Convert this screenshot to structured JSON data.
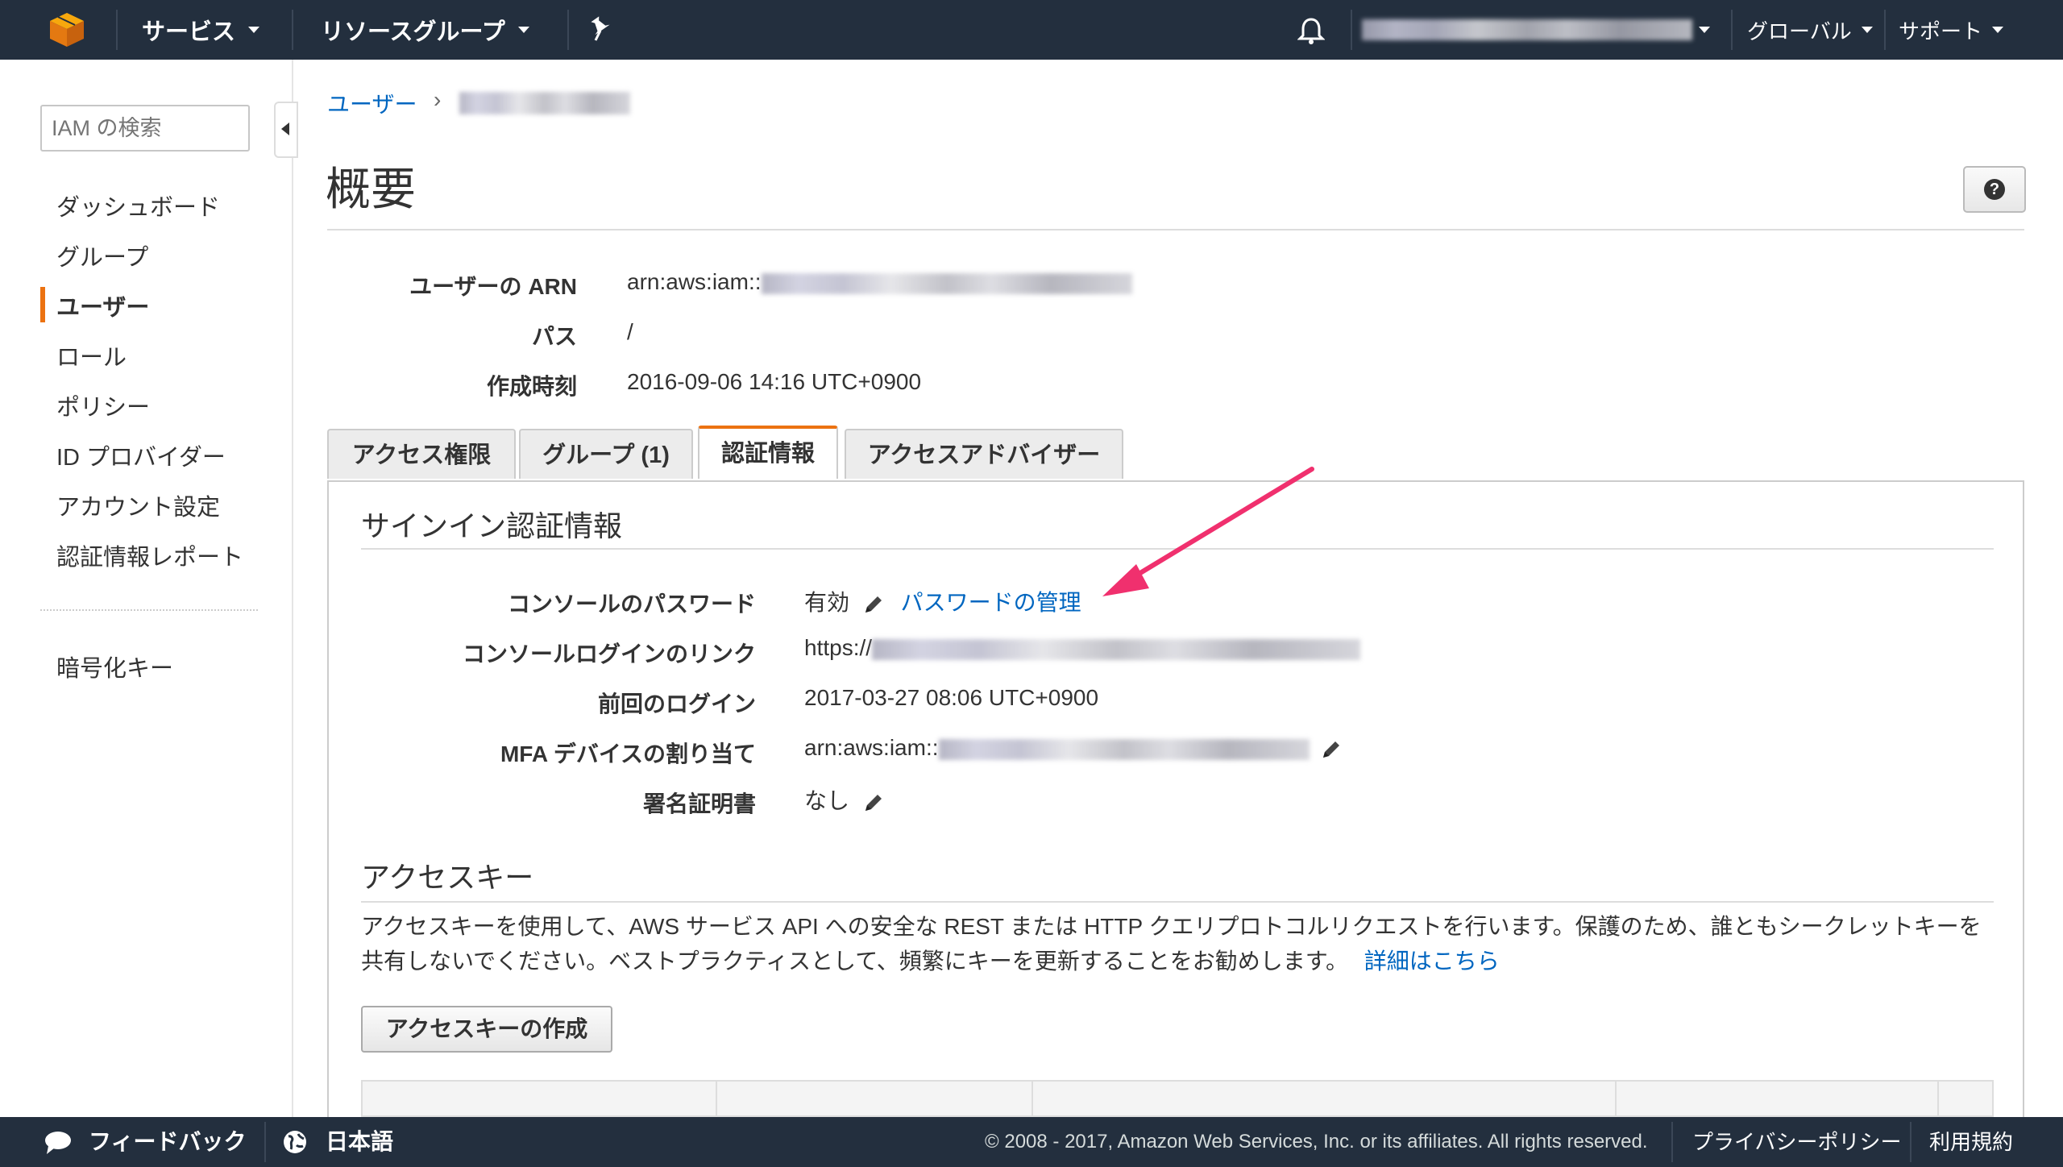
{
  "topbar": {
    "services_label": "サービス",
    "resource_groups_label": "リソースグループ",
    "region_label": "グローバル",
    "support_label": "サポート"
  },
  "sidebar": {
    "search_placeholder": "IAM の検索",
    "items": [
      {
        "label": "ダッシュボード"
      },
      {
        "label": "グループ"
      },
      {
        "label": "ユーザー",
        "active": true
      },
      {
        "label": "ロール"
      },
      {
        "label": "ポリシー"
      },
      {
        "label": "ID プロバイダー"
      },
      {
        "label": "アカウント設定"
      },
      {
        "label": "認証情報レポート"
      }
    ],
    "extra_item": "暗号化キー"
  },
  "breadcrumb": {
    "root": "ユーザー"
  },
  "page": {
    "title": "概要",
    "help_symbol": "?"
  },
  "summary": {
    "arn_label": "ユーザーの ARN",
    "arn_prefix": "arn:aws:iam::",
    "path_label": "パス",
    "path_value": "/",
    "created_label": "作成時刻",
    "created_value": "2016-09-06 14:16 UTC+0900"
  },
  "tabs": [
    {
      "label": "アクセス権限"
    },
    {
      "label": "グループ (1)"
    },
    {
      "label": "認証情報",
      "active": true
    },
    {
      "label": "アクセスアドバイザー"
    }
  ],
  "signin": {
    "title": "サインイン認証情報",
    "console_password_label": "コンソールのパスワード",
    "console_password_value": "有効",
    "manage_password_link": "パスワードの管理",
    "console_link_label": "コンソールログインのリンク",
    "console_link_prefix": "https://",
    "last_login_label": "前回のログイン",
    "last_login_value": "2017-03-27 08:06 UTC+0900",
    "mfa_label": "MFA デバイスの割り当て",
    "mfa_prefix": "arn:aws:iam::",
    "signing_cert_label": "署名証明書",
    "signing_cert_value": "なし"
  },
  "access_keys": {
    "title": "アクセスキー",
    "description": "アクセスキーを使用して、AWS サービス API への安全な REST または HTTP クエリプロトコルリクエストを行います。保護のため、誰ともシークレットキーを共有しないでください。ベストプラクティスとして、頻繁にキーを更新することをお勧めします。",
    "learn_more_link": "詳細はこちら",
    "create_button": "アクセスキーの作成"
  },
  "footer": {
    "feedback": "フィードバック",
    "language": "日本語",
    "copyright": "© 2008 - 2017, Amazon Web Services, Inc. or its affiliates. All rights reserved.",
    "privacy": "プライバシーポリシー",
    "terms": "利用規約"
  },
  "colors": {
    "topbar": "#232f3e",
    "accent": "#ec7211",
    "link": "#0066c0",
    "annotation_arrow": "#f0306e"
  }
}
